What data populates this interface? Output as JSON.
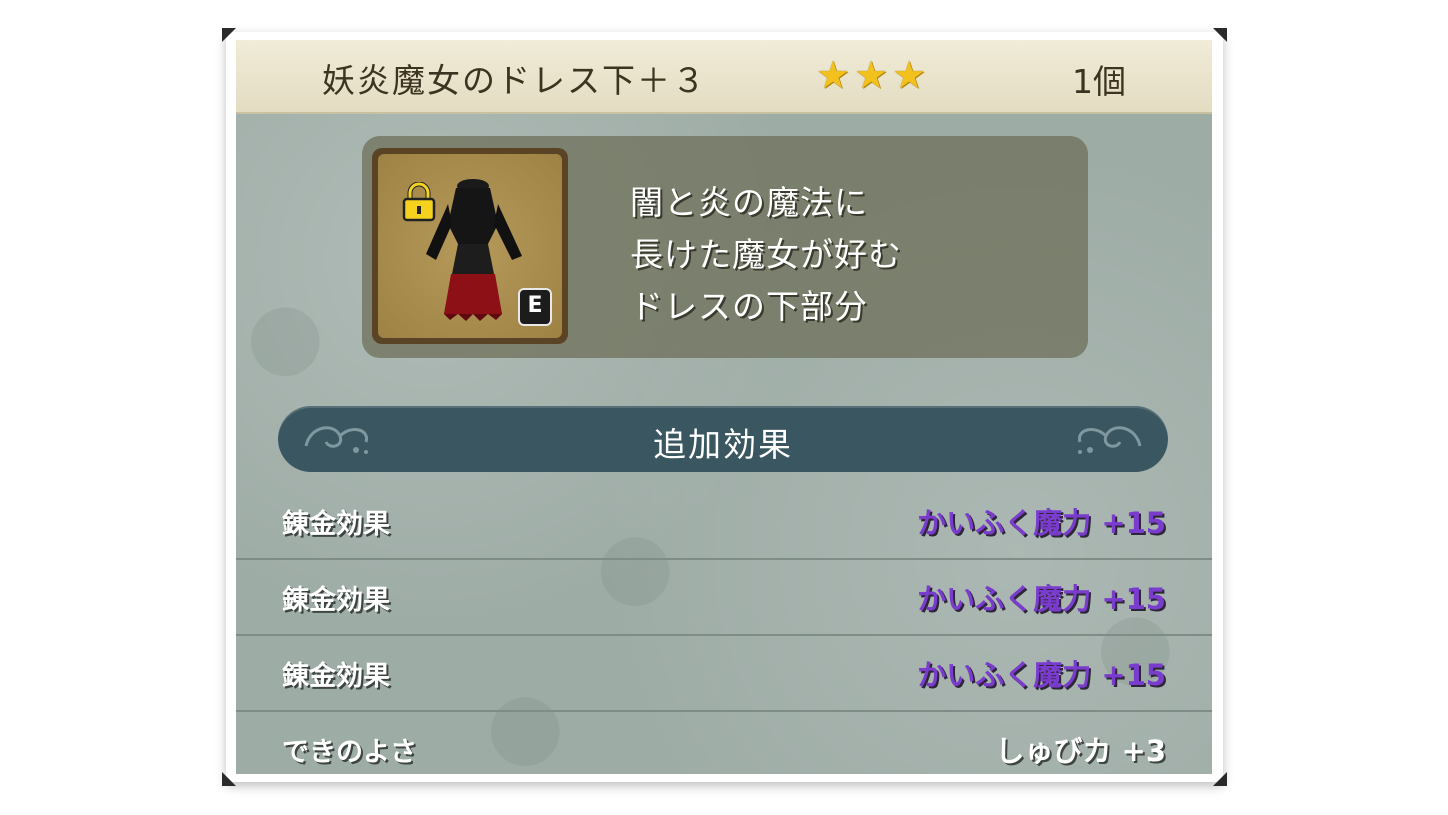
{
  "item": {
    "name": "妖炎魔女のドレス下＋３",
    "stars": "★★★",
    "count": "1個",
    "equipped_badge": "E",
    "description": [
      "闇と炎の魔法に",
      "長けた魔女が好む",
      "ドレスの下部分"
    ]
  },
  "section": {
    "title": "追加効果"
  },
  "effects": [
    {
      "label": "錬金効果",
      "value": "かいふく魔力 +15",
      "value_color": "#7a3ccc"
    },
    {
      "label": "錬金効果",
      "value": "かいふく魔力 +15",
      "value_color": "#7a3ccc"
    },
    {
      "label": "錬金効果",
      "value": "かいふく魔力 +15",
      "value_color": "#7a3ccc"
    },
    {
      "label": "できのよさ",
      "value": "しゅびカ +3",
      "value_color": "#ffffff"
    }
  ],
  "colors": {
    "title_bg": "#ebe5cd",
    "panel_bg": "#9eaca6",
    "section_bar": "#3a5660",
    "star": "#f2c11e"
  },
  "icons": [
    "lock-icon",
    "dress-icon",
    "star-icon",
    "flourish-icon"
  ]
}
